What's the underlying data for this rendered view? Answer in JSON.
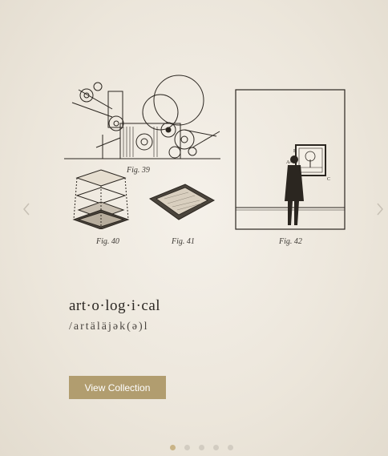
{
  "slider": {
    "prev_icon": "chevron-left-icon",
    "next_icon": "chevron-right-icon",
    "figures": [
      {
        "caption": "Fig. 39"
      },
      {
        "caption": "Fig. 40"
      },
      {
        "caption": "Fig. 41"
      },
      {
        "caption": "Fig. 42"
      }
    ]
  },
  "entry": {
    "word": "art·o·log·i·cal",
    "pronunciation": "/artäläjək(ə)l"
  },
  "cta": {
    "label": "View Collection"
  },
  "pagination": {
    "count": 5,
    "active_index": 0
  },
  "colors": {
    "accent": "#b19d6f",
    "dot_active": "#c9b487",
    "dot_inactive": "#d2ccc1"
  }
}
